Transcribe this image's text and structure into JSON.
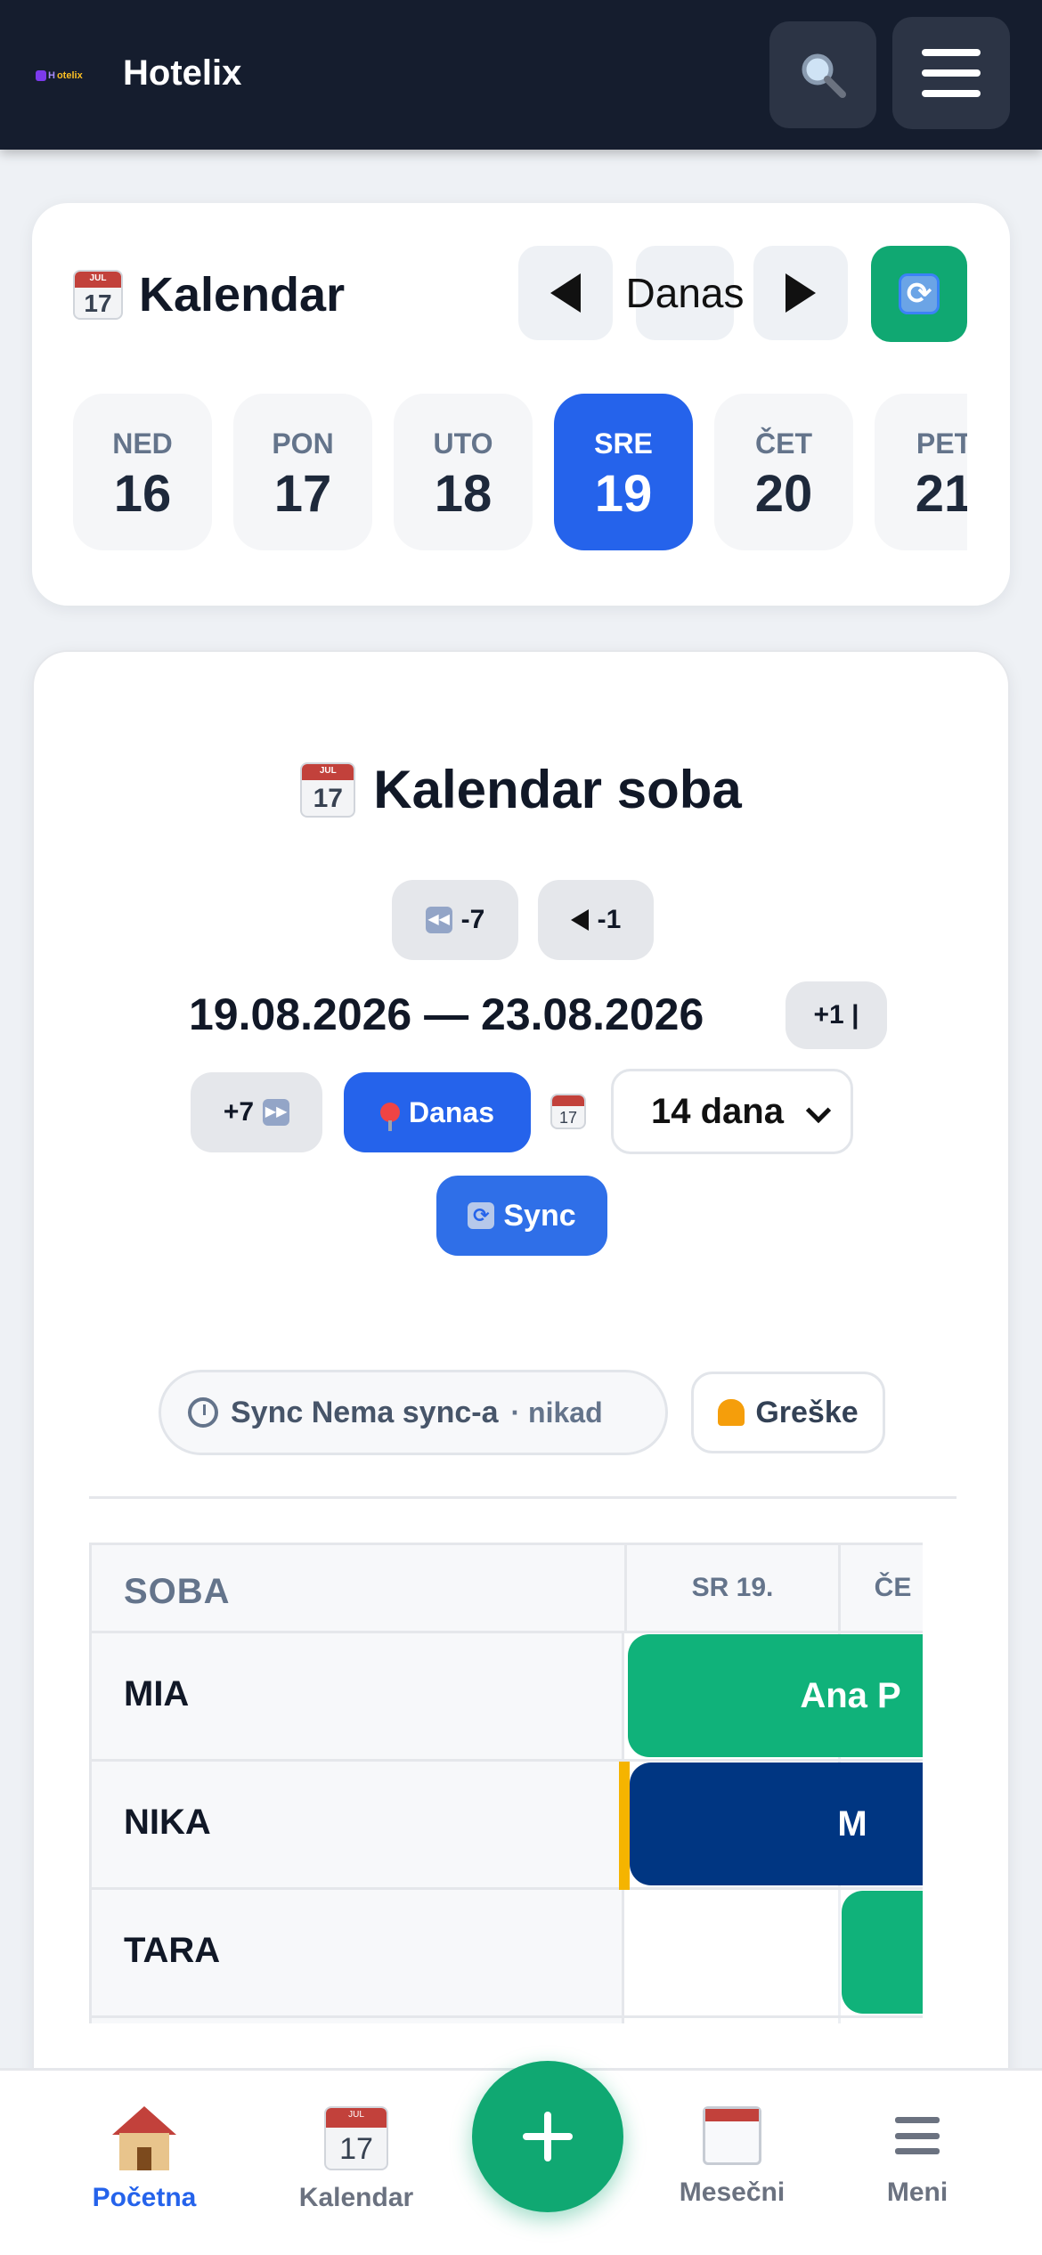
{
  "header": {
    "logo_text": "Hotelix",
    "app_title": "Hotelix",
    "search_icon": "search-icon",
    "menu_icon": "hamburger-icon"
  },
  "calendar_widget": {
    "title": "Kalendar",
    "today_label": "Danas",
    "days": [
      {
        "name": "NED",
        "num": "16",
        "active": false
      },
      {
        "name": "PON",
        "num": "17",
        "active": false
      },
      {
        "name": "UTO",
        "num": "18",
        "active": false
      },
      {
        "name": "SRE",
        "num": "19",
        "active": true
      },
      {
        "name": "ČET",
        "num": "20",
        "active": false
      },
      {
        "name": "PET",
        "num": "21",
        "active": false
      }
    ]
  },
  "room_calendar": {
    "title": "Kalendar soba",
    "minus7_label": "-7",
    "minus1_label": "-1",
    "date_range": "19.08.2026 — 23.08.2026",
    "plus1_label": "+1 |",
    "plus7_label": "+7",
    "today_label": "Danas",
    "period_select": "14 dana",
    "sync_label": "Sync",
    "sync_status_label": "Sync Nema sync-a",
    "sync_status_time": "· nikad",
    "errors_label": "Greške",
    "table": {
      "col_room": "SOBA",
      "col_day1": "SR 19.",
      "col_day2": "ČE",
      "rooms": [
        {
          "name": "MIA",
          "booking": "Ana P"
        },
        {
          "name": "NIKA",
          "booking": "M"
        },
        {
          "name": "TARA",
          "booking": ""
        }
      ]
    }
  },
  "bottom_nav": {
    "home": "Početna",
    "calendar": "Kalendar",
    "monthly": "Mesečni",
    "menu": "Meni"
  },
  "colors": {
    "header_bg": "#151d2e",
    "primary_blue": "#2563eb",
    "accent_green": "#10a872",
    "booking_navy": "#003682",
    "accent_yellow": "#f5b400"
  }
}
